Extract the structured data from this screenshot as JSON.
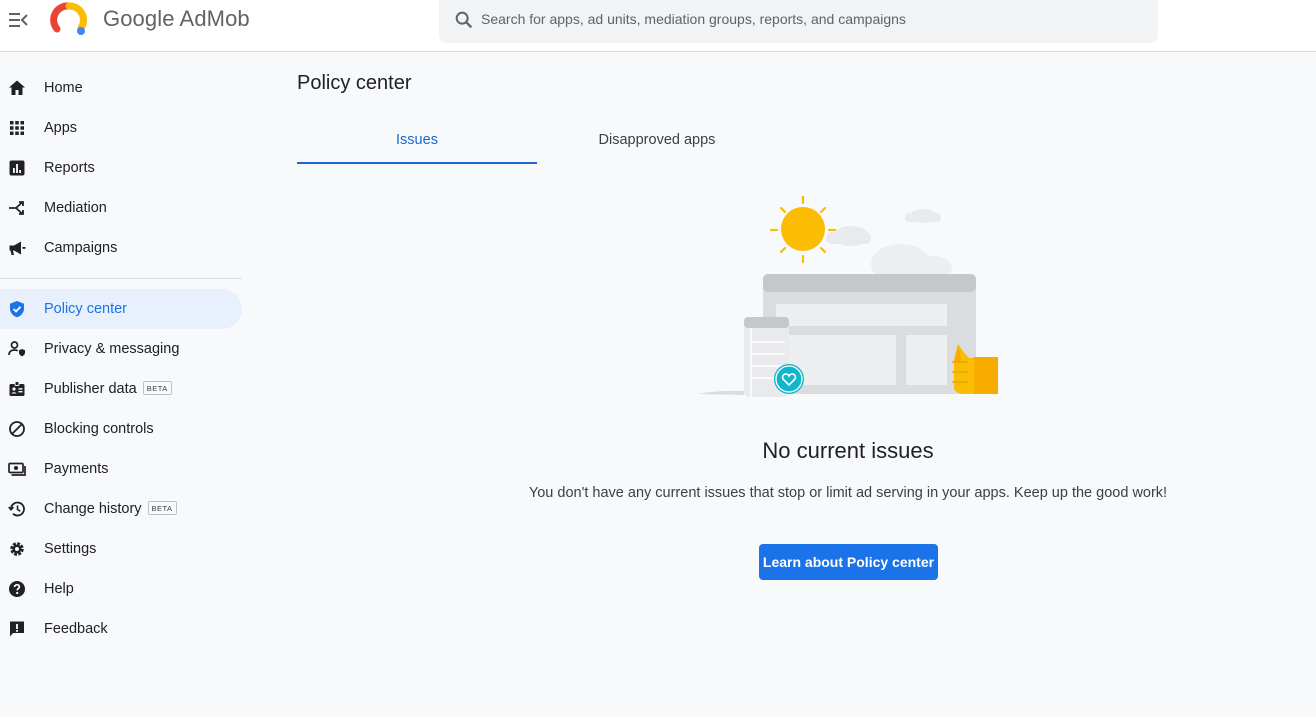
{
  "header": {
    "menu_icon": "menu-collapse-icon",
    "logo_icon": "admob-logo",
    "brand": "Google AdMob",
    "search": {
      "placeholder": "Search for apps, ad units, mediation groups, reports, and campaigns",
      "value": ""
    }
  },
  "sidebar": {
    "items": [
      {
        "label": "Home",
        "icon": "home-icon"
      },
      {
        "label": "Apps",
        "icon": "apps-grid-icon"
      },
      {
        "label": "Reports",
        "icon": "reports-icon"
      },
      {
        "label": "Mediation",
        "icon": "mediation-icon"
      },
      {
        "label": "Campaigns",
        "icon": "megaphone-icon"
      },
      {
        "label": "Policy center",
        "icon": "shield-check-icon",
        "active": true
      },
      {
        "label": "Privacy & messaging",
        "icon": "person-shield-icon"
      },
      {
        "label": "Publisher data",
        "icon": "badge-icon",
        "badge": "BETA"
      },
      {
        "label": "Blocking controls",
        "icon": "block-icon"
      },
      {
        "label": "Payments",
        "icon": "payments-icon"
      },
      {
        "label": "Change history",
        "icon": "history-icon",
        "badge": "BETA"
      },
      {
        "label": "Settings",
        "icon": "gear-icon"
      },
      {
        "label": "Help",
        "icon": "help-icon"
      },
      {
        "label": "Feedback",
        "icon": "feedback-icon"
      }
    ]
  },
  "main": {
    "title": "Policy center",
    "tabs": [
      {
        "label": "Issues",
        "active": true
      },
      {
        "label": "Disapproved apps",
        "active": false
      }
    ],
    "empty_state": {
      "title": "No current issues",
      "description": "You don't have any current issues that stop or limit ad serving in your apps. Keep up the good work!",
      "button": "Learn about Policy center"
    }
  },
  "colors": {
    "accent": "#1a73e8",
    "active_bg": "#e8f0fe",
    "background": "#f8f9fa"
  }
}
